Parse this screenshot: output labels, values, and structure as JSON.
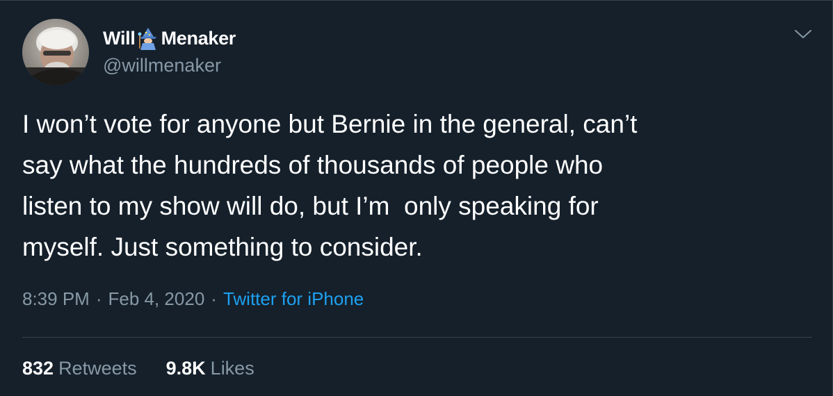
{
  "author": {
    "name_first": "Will",
    "emoji_icon": "wizard-emoji-icon",
    "name_last": "Menaker",
    "handle": "@willmenaker",
    "avatar_icon": "profile-photo"
  },
  "tweet": {
    "text": "I won’t vote for anyone but Bernie in the general, can’t\nsay what the hundreds of thousands of people who\nlisten to my show will do, but I’m  only speaking for\nmyself. Just something to consider.",
    "time": "8:39 PM",
    "date": "Feb 4, 2020",
    "separator": "·",
    "source": "Twitter for iPhone"
  },
  "stats": {
    "retweets_count": "832",
    "retweets_label": "Retweets",
    "likes_count": "9.8K",
    "likes_label": "Likes"
  },
  "menu": {
    "icon": "chevron-down-icon"
  },
  "colors": {
    "background": "#15202b",
    "text": "#ffffff",
    "secondary_text": "#8899a6",
    "link": "#1da1f2",
    "border": "#38444d"
  }
}
